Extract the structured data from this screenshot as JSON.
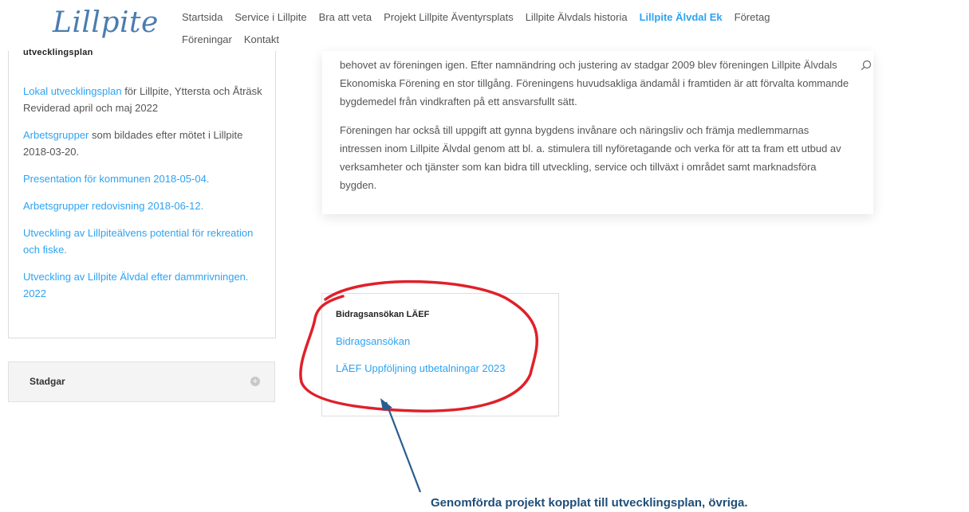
{
  "header": {
    "logo": "Lillpite",
    "nav_row1": [
      "Startsida",
      "Service i Lillpite",
      "Bra att veta",
      "Projekt Lillpite Äventyrsplats",
      "Lillpite Älvdals historia",
      "Lillpite Älvdal Ek",
      "Företag"
    ],
    "nav_row2": [
      "Föreningar",
      "Kontakt"
    ],
    "active_item": "Lillpite Älvdal Ek"
  },
  "sidebar": {
    "widget_title": "utvecklingsplan",
    "items": [
      {
        "link": "Lokal utvecklingsplan",
        "rest": " för Lillpite, Yttersta och Åträsk Reviderad april och maj 2022"
      },
      {
        "link": "Arbetsgrupper",
        "rest": " som bildades efter mötet i Lillpite 2018-03-20."
      },
      {
        "link": "Presentation för kommunen 2018-05-04.",
        "rest": ""
      },
      {
        "link": "Arbetsgrupper redovisning 2018-06-12.",
        "rest": ""
      },
      {
        "link": "Utveckling av Lillpiteälvens potential för rekreation och fiske.",
        "rest": ""
      },
      {
        "link": "Utveckling av Lillpite Älvdal efter dammrivningen. 2022",
        "rest": ""
      }
    ],
    "stadgar": {
      "title": "Stadgar",
      "toggle": "+"
    }
  },
  "main": {
    "paragraph1": "behovet av föreningen igen. Efter namnändring och justering av stadgar 2009 blev föreningen Lillpite Älvdals Ekonomiska Förening en stor tillgång. Föreningens huvudsakliga ändamål i framtiden är att förvalta kommande bygdemedel från vindkraften på ett ansvarsfullt sätt.",
    "paragraph2": "Föreningen har också till uppgift att gynna bygdens invånare och näringsliv och främja medlemmarnas intressen inom Lillpite Älvdal genom att bl. a. stimulera till nyföretagande och verka för att ta fram ett utbud av verksamheter och tjänster som kan bidra till utveckling, service och tillväxt i området samt marknadsföra bygden."
  },
  "bidrag": {
    "title": "Bidragsansökan LÄEF",
    "link1": "Bidragsansökan",
    "link2": "LÄEF Uppföljning utbetalningar 2023"
  },
  "annotation": {
    "caption": "Genomförda projekt kopplat till utvecklingsplan, övriga.",
    "circle_color": "#e0202a",
    "arrow_color": "#2a5d8f"
  },
  "colors": {
    "link": "#2ea3f2",
    "logo": "#4a7db0"
  }
}
